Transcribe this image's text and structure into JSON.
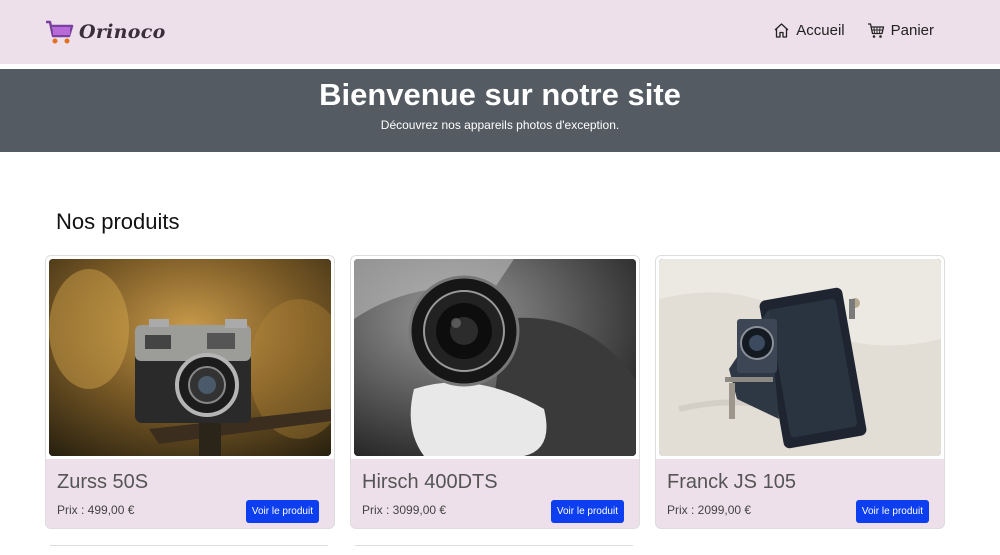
{
  "brand": {
    "name": "Orinoco",
    "icon": "shopping-cart-logo",
    "accent": "#9b5de5"
  },
  "nav": {
    "home_label": "Accueil",
    "home_icon": "house-icon",
    "cart_label": "Panier",
    "cart_icon": "cart-icon"
  },
  "hero": {
    "title": "Bienvenue sur notre site",
    "subtitle": "Découvrez nos appareils photos d'exception."
  },
  "products_section": {
    "title": "Nos produits"
  },
  "products": [
    {
      "name": "Zurss 50S",
      "price": "Prix : 499,00 €",
      "button": "Voir le produit"
    },
    {
      "name": "Hirsch 400DTS",
      "price": "Prix : 3099,00 €",
      "button": "Voir le produit"
    },
    {
      "name": "Franck JS 105",
      "price": "Prix : 2099,00 €",
      "button": "Voir le produit"
    }
  ],
  "colors": {
    "navbar": "#ede0ea",
    "hero": "#545b62",
    "button": "#0d3ef0"
  }
}
